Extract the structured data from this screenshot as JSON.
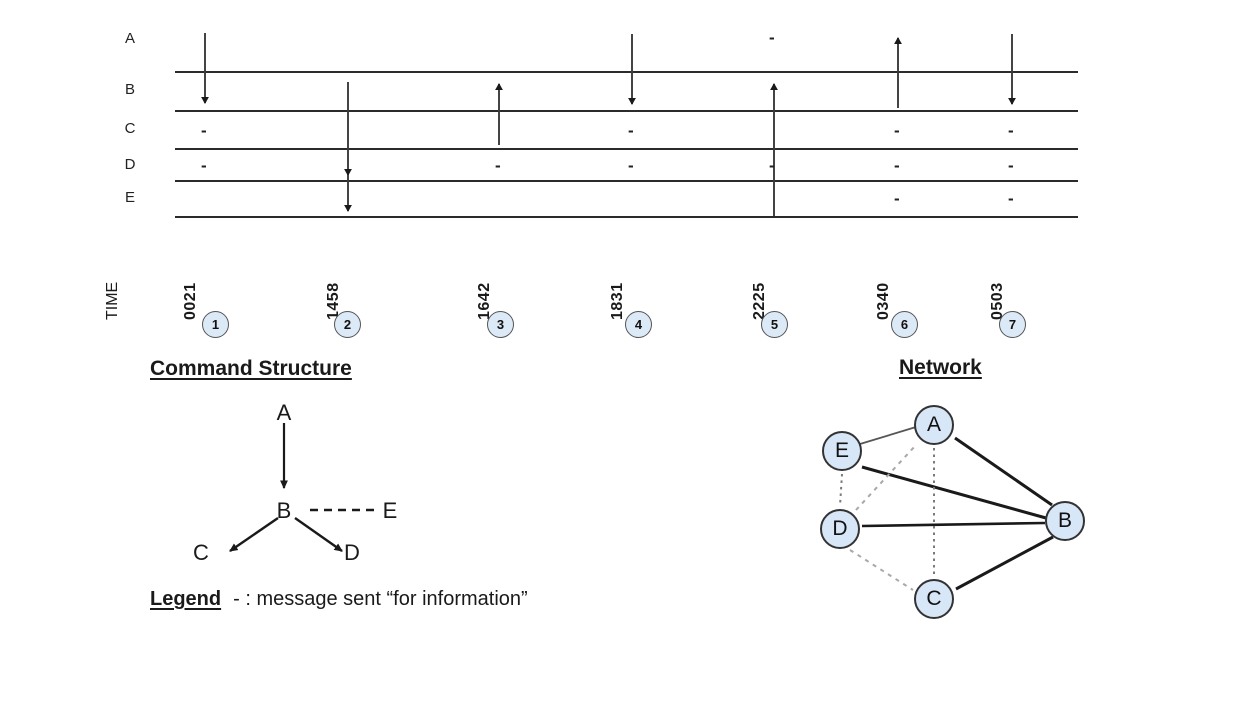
{
  "diagram": {
    "timeline": {
      "axis_title": "TIME",
      "rows": [
        {
          "id": "A",
          "label": "A"
        },
        {
          "id": "B",
          "label": "B"
        },
        {
          "id": "C",
          "label": "C"
        },
        {
          "id": "D",
          "label": "D"
        },
        {
          "id": "E",
          "label": "E"
        }
      ],
      "events": [
        {
          "num": "1",
          "time": "0021",
          "arrow": {
            "from": "A",
            "to": "B",
            "direction": "down"
          },
          "info_marks": [
            "C",
            "D"
          ]
        },
        {
          "num": "2",
          "time": "1458",
          "arrow": {
            "from": "B",
            "to": "E",
            "direction": "down"
          },
          "info_marks": []
        },
        {
          "num": "3",
          "time": "1642",
          "arrow": {
            "from": "C",
            "to": "B",
            "direction": "up"
          },
          "info_marks": [
            "D"
          ]
        },
        {
          "num": "4",
          "time": "1831",
          "arrow": {
            "from": "A",
            "to": "B",
            "direction": "down"
          },
          "info_marks": [
            "C",
            "D"
          ]
        },
        {
          "num": "5",
          "time": "2225",
          "arrow": {
            "from": "E",
            "to": "B",
            "direction": "up"
          },
          "info_marks": [
            "A",
            "D"
          ]
        },
        {
          "num": "6",
          "time": "0340",
          "arrow": {
            "from": "B",
            "to": "A",
            "direction": "up"
          },
          "info_marks": [
            "C",
            "D",
            "E"
          ]
        },
        {
          "num": "7",
          "time": "0503",
          "arrow": {
            "from": "A",
            "to": "B",
            "direction": "down"
          },
          "info_marks": [
            "C",
            "D",
            "E"
          ]
        }
      ],
      "info_mark_glyph": "-"
    },
    "command_structure": {
      "heading": "Command Structure",
      "nodes": [
        "A",
        "B",
        "C",
        "D",
        "E"
      ],
      "labels": {
        "A": "A",
        "B": "B",
        "C": "C",
        "D": "D",
        "E": "E"
      },
      "edges": [
        {
          "from": "A",
          "to": "B",
          "style": "solid-arrow"
        },
        {
          "from": "B",
          "to": "C",
          "style": "solid-arrow"
        },
        {
          "from": "B",
          "to": "D",
          "style": "solid-arrow"
        },
        {
          "from": "B",
          "to": "E",
          "style": "dashed"
        }
      ]
    },
    "network": {
      "heading": "Network",
      "nodes": [
        {
          "id": "A",
          "label": "A"
        },
        {
          "id": "B",
          "label": "B"
        },
        {
          "id": "C",
          "label": "C"
        },
        {
          "id": "D",
          "label": "D"
        },
        {
          "id": "E",
          "label": "E"
        }
      ],
      "edges": [
        {
          "from": "A",
          "to": "B",
          "style": "solid"
        },
        {
          "from": "A",
          "to": "E",
          "style": "thin"
        },
        {
          "from": "A",
          "to": "C",
          "style": "dotted"
        },
        {
          "from": "A",
          "to": "D",
          "style": "dotted"
        },
        {
          "from": "E",
          "to": "B",
          "style": "solid"
        },
        {
          "from": "E",
          "to": "D",
          "style": "dotted"
        },
        {
          "from": "D",
          "to": "B",
          "style": "solid"
        },
        {
          "from": "D",
          "to": "C",
          "style": "dotted"
        },
        {
          "from": "C",
          "to": "B",
          "style": "solid"
        }
      ]
    },
    "legend": {
      "title": "Legend",
      "text": "- : message sent “for information”"
    },
    "colors": {
      "node_fill": "#d7e7f8",
      "circle_fill": "#dce9f7",
      "stroke": "#333333",
      "text": "#1a1a1a"
    }
  }
}
